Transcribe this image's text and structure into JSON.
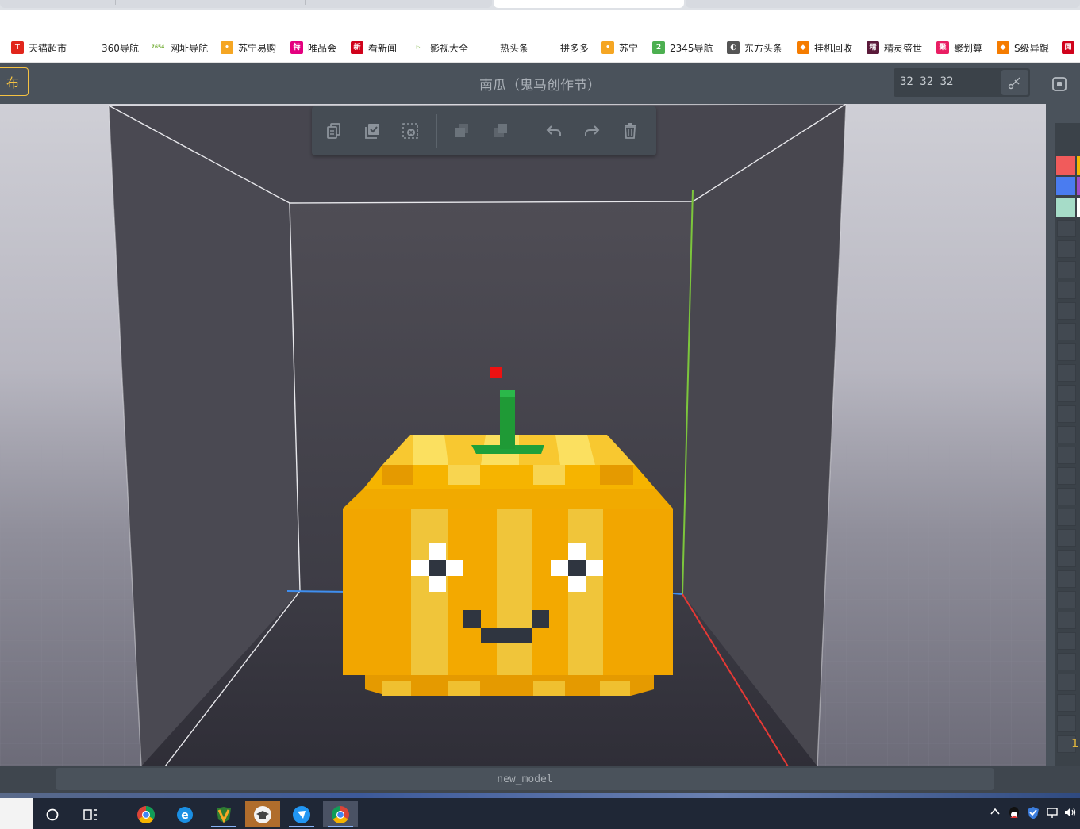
{
  "browser": {
    "bookmarks": [
      {
        "label": "天猫超市",
        "icon": "tmall-icon",
        "color": "#e1251b",
        "glyph": "T"
      },
      {
        "label": "360导航",
        "icon": "360-icon",
        "color": "#ffffff",
        "glyph": ""
      },
      {
        "label": "网址导航",
        "icon": "7654-icon",
        "color": "#ffffff",
        "glyph": "7654"
      },
      {
        "label": "苏宁易购",
        "icon": "suning-icon",
        "color": "#f5a623",
        "glyph": "•"
      },
      {
        "label": "唯品会",
        "icon": "vip-icon",
        "color": "#e4007f",
        "glyph": "特"
      },
      {
        "label": "看新闻",
        "icon": "news-icon",
        "color": "#d0021b",
        "glyph": "新"
      },
      {
        "label": "影视大全",
        "icon": "video-icon",
        "color": "#ffffff",
        "glyph": "▷"
      },
      {
        "label": "热头条",
        "icon": "toutiao-icon",
        "color": "#ffffff",
        "glyph": ""
      },
      {
        "label": "拼多多",
        "icon": "pdd-icon",
        "color": "#ffffff",
        "glyph": ""
      },
      {
        "label": "苏宁",
        "icon": "suning2-icon",
        "color": "#f5a623",
        "glyph": "•"
      },
      {
        "label": "2345导航",
        "icon": "2345-icon",
        "color": "#4caf50",
        "glyph": "2"
      },
      {
        "label": "东方头条",
        "icon": "dongfang-icon",
        "color": "#555555",
        "glyph": "◐"
      },
      {
        "label": "挂机回收",
        "icon": "game-icon",
        "color": "#f57c00",
        "glyph": "◆"
      },
      {
        "label": "精灵盛世",
        "icon": "sprite-icon",
        "color": "#5a1a3a",
        "glyph": "精"
      },
      {
        "label": "聚划算",
        "icon": "juhuasuan-icon",
        "color": "#e91e63",
        "glyph": "聚"
      },
      {
        "label": "S级异鲲",
        "icon": "kun-icon",
        "color": "#f57c00",
        "glyph": "◆"
      },
      {
        "label": "",
        "icon": "overflow-icon",
        "color": "#d0021b",
        "glyph": "闻"
      }
    ]
  },
  "header": {
    "publish_label": "布",
    "title": "南瓜（鬼马创作节）",
    "size_text": "32  32  32"
  },
  "toolbar": {
    "buttons": [
      "copy-icon",
      "select-all-icon",
      "deselect-icon",
      "group-icon",
      "ungroup-icon",
      "undo-icon",
      "redo-icon",
      "delete-icon"
    ]
  },
  "palette": {
    "colors": [
      "#f15b5b",
      "#4a7cf0",
      "#a6dcc8"
    ],
    "partial_colors": [
      "#f5b800",
      "#a04ec8",
      "#ffffff"
    ],
    "bottom_number": "1"
  },
  "model": {
    "name": "new_model"
  },
  "taskbar": {
    "apps": [
      "search-icon",
      "task-view-icon",
      "chrome-icon",
      "ie-icon",
      "shield-app-icon",
      "edu-app-icon",
      "feather-app-icon",
      "chrome-2-icon"
    ]
  },
  "accent_colors": {
    "publish": "#f5c242",
    "axis_x": "#e53935",
    "axis_y": "#7cc63c",
    "axis_z": "#3f8ef0",
    "pumpkin": "#f5b800"
  }
}
